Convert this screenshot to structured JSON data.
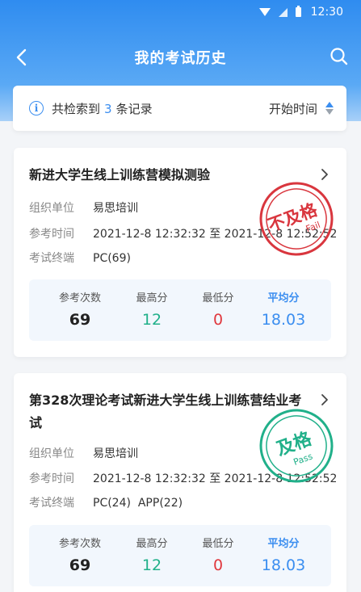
{
  "status": {
    "time": "12:30"
  },
  "nav": {
    "title": "我的考试历史"
  },
  "filter": {
    "prefix": "共检索到",
    "count": "3",
    "suffix": "条记录",
    "sort_label": "开始时间"
  },
  "labels": {
    "org": "组织单位",
    "time": "参考时间",
    "device": "考试终端",
    "attempts": "参考次数",
    "max": "最高分",
    "min": "最低分",
    "avg": "平均分"
  },
  "records": [
    {
      "title": "新进大学生线上训练营模拟测验",
      "org": "易思培训",
      "time": "2021-12-8 12:32:32 至 2021-12-8 12:52:52",
      "device": "PC(69)",
      "attempts": "69",
      "max": "12",
      "min": "0",
      "avg": "18.03",
      "stamp_cn": "不及格",
      "stamp_en": "Fail"
    },
    {
      "title": "第328次理论考试新进大学生线上训练营结业考试",
      "org": "易思培训",
      "time": "2021-12-8 12:32:32 至 2021-12-8 12:52:52",
      "device": "PC(24)  APP(22)",
      "attempts": "69",
      "max": "12",
      "min": "0",
      "avg": "18.03",
      "stamp_cn": "及格",
      "stamp_en": "Pass"
    }
  ],
  "colors": {
    "primary": "#3b8ef0",
    "fail": "#d9363e",
    "pass": "#21b08a"
  }
}
